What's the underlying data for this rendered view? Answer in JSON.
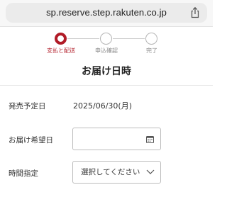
{
  "browser": {
    "url": "sp.reserve.step.rakuten.co.jp"
  },
  "stepper": {
    "steps": [
      {
        "label": "支払と配送",
        "active": true
      },
      {
        "label": "申込確認",
        "active": false
      },
      {
        "label": "完了",
        "active": false
      }
    ]
  },
  "page": {
    "title": "お届け日時"
  },
  "form": {
    "release_date_label": "発売予定日",
    "release_date_value": "2025/06/30(月)",
    "delivery_date_label": "お届け希望日",
    "delivery_date_value": "",
    "time_label": "時間指定",
    "time_selected": "選択してください"
  },
  "colors": {
    "accent": "#b11b27",
    "inactive": "#b5b5b5"
  }
}
